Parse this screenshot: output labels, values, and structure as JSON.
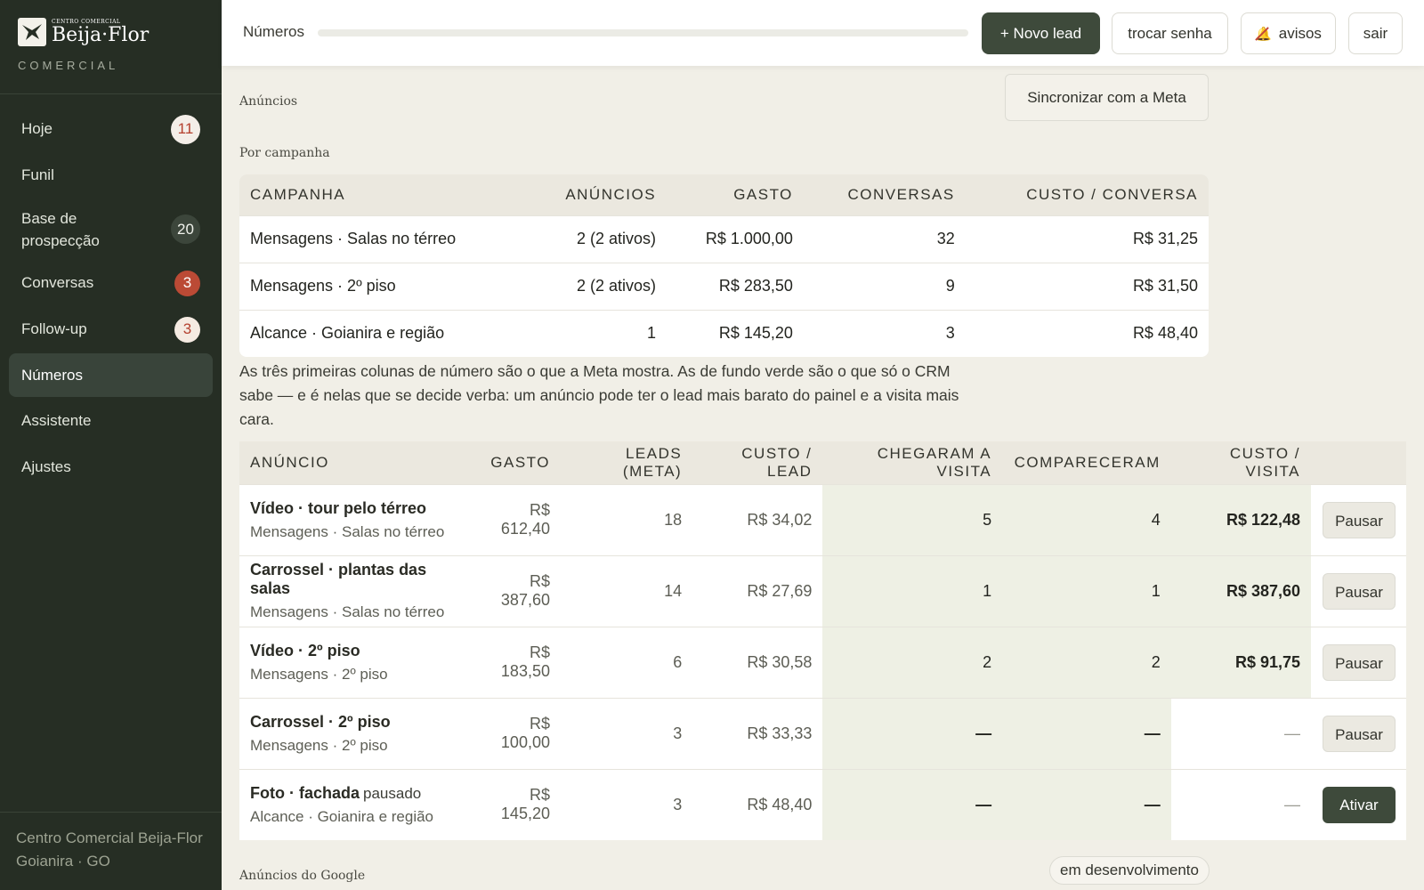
{
  "brand": {
    "small": "CENTRO COMERCIAL",
    "name": "Beija·Flor",
    "sub": "COMERCIAL",
    "logo_icon": "hummingbird-icon"
  },
  "sidebar": {
    "items": [
      {
        "label": "Hoje",
        "badge": "11"
      },
      {
        "label": "Funil"
      },
      {
        "label": "Base de prospecção",
        "badge": "20"
      },
      {
        "label": "Conversas",
        "badge": "3"
      },
      {
        "label": "Follow-up",
        "badge": "3"
      },
      {
        "label": "Números"
      },
      {
        "label": "Assistente"
      },
      {
        "label": "Ajustes"
      }
    ],
    "footer_line1": "Centro Comercial Beija-Flor",
    "footer_line2": "Goianira · GO"
  },
  "topbar": {
    "title": "Números",
    "new_lead": "+ Novo lead",
    "change_password": "trocar senha",
    "notifications": "avisos",
    "logout": "sair",
    "notifications_icon": "bell-muted-icon"
  },
  "ads_section": {
    "label": "Anúncios",
    "sync_button": "Sincronizar com a Meta"
  },
  "campaigns": {
    "label": "Por campanha",
    "headers": [
      "CAMPANHA",
      "ANÚNCIOS",
      "GASTO",
      "CONVERSAS",
      "CUSTO / CONVERSA"
    ],
    "rows": [
      [
        "Mensagens · Salas no térreo",
        "2 (2 ativos)",
        "R$ 1.000,00",
        "32",
        "R$ 31,25"
      ],
      [
        "Mensagens · 2º piso",
        "2 (2 ativos)",
        "R$ 283,50",
        "9",
        "R$ 31,50"
      ],
      [
        "Alcance · Goianira e região",
        "1",
        "R$ 145,20",
        "3",
        "R$ 48,40"
      ]
    ]
  },
  "note": "As três primeiras colunas de número são o que a Meta mostra. As de fundo verde são o que só o CRM sabe — e é nelas que se decide verba: um anúncio pode ter o lead mais barato do painel e a visita mais cara.",
  "ads": {
    "headers": [
      "ANÚNCIO",
      "GASTO",
      "LEADS (META)",
      "CUSTO / LEAD",
      "CHEGARAM A VISITA",
      "COMPARECERAM",
      "CUSTO / VISITA",
      ""
    ],
    "rows": [
      {
        "name": "Vídeo · tour pelo térreo",
        "status": "",
        "campaign": "Mensagens · Salas no térreo",
        "spend": "R$ 612,40",
        "leads": "18",
        "cpl": "R$ 34,02",
        "visits": "5",
        "attended": "4",
        "cpv": "R$ 122,48",
        "action": "Pausar"
      },
      {
        "name": "Carrossel · plantas das salas",
        "status": "",
        "campaign": "Mensagens · Salas no térreo",
        "spend": "R$ 387,60",
        "leads": "14",
        "cpl": "R$ 27,69",
        "visits": "1",
        "attended": "1",
        "cpv": "R$ 387,60",
        "action": "Pausar"
      },
      {
        "name": "Vídeo · 2º piso",
        "status": "",
        "campaign": "Mensagens · 2º piso",
        "spend": "R$ 183,50",
        "leads": "6",
        "cpl": "R$ 30,58",
        "visits": "2",
        "attended": "2",
        "cpv": "R$ 91,75",
        "action": "Pausar"
      },
      {
        "name": "Carrossel · 2º piso",
        "status": "",
        "campaign": "Mensagens · 2º piso",
        "spend": "R$ 100,00",
        "leads": "3",
        "cpl": "R$ 33,33",
        "visits": "—",
        "attended": "—",
        "cpv": "—",
        "action": "Pausar"
      },
      {
        "name": "Foto · fachada",
        "status": "pausado",
        "campaign": "Alcance · Goianira e região",
        "spend": "R$ 145,20",
        "leads": "3",
        "cpl": "R$ 48,40",
        "visits": "—",
        "attended": "—",
        "cpv": "—",
        "action": "Ativar"
      }
    ]
  },
  "google": {
    "label": "Anúncios do Google",
    "status": "em desenvolvimento"
  },
  "colors": {
    "sidebar_bg": "#262e24",
    "primary": "#3e4a3b",
    "accent_green_bg": "#eef0e4",
    "badge_red": "#bb4a35"
  }
}
